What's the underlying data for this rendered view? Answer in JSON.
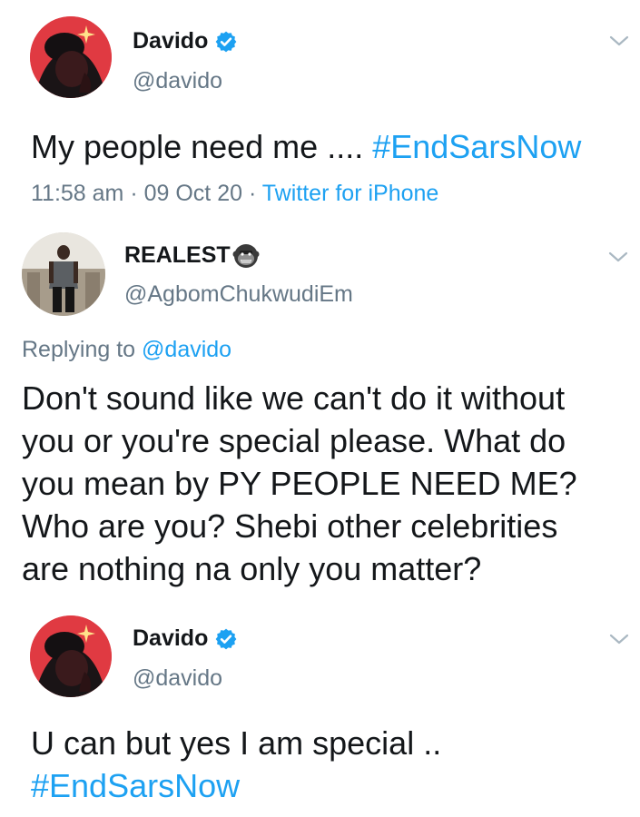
{
  "colors": {
    "accent": "#1da1f2",
    "secondary_text": "#657786",
    "text": "#14171a"
  },
  "tweets": [
    {
      "name": "Davido",
      "verified": true,
      "handle": "@davido",
      "text": "My people need me .... ",
      "hashtag": "#EndSarsNow",
      "time": "11:58 am",
      "sep1": " · ",
      "date": "09 Oct 20",
      "sep2": " · ",
      "source": "Twitter for iPhone",
      "avatar_icon": "avatar-davido"
    },
    {
      "name": "REALEST",
      "name_emoji": "gorilla-emoji",
      "handle": "@AgbomChukwudiEm",
      "replying_prefix": "Replying to ",
      "replying_to": "@davido",
      "lines": [
        "Don't sound like we can't do it without",
        "you or you're special please. What do",
        "you mean by PY PEOPLE NEED ME?",
        "Who are you? Shebi other celebrities",
        "are nothing na only you matter?"
      ],
      "avatar_icon": "avatar-realest"
    },
    {
      "name": "Davido",
      "verified": true,
      "handle": "@davido",
      "text": "U can but yes I am special ..",
      "hashtag": "#EndSarsNow",
      "avatar_icon": "avatar-davido"
    }
  ]
}
